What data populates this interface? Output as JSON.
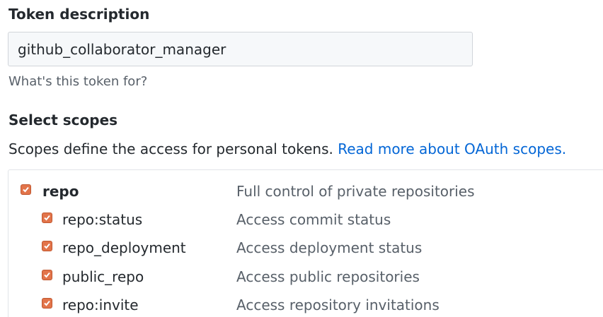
{
  "token": {
    "label": "Token description",
    "value": "github_collaborator_manager",
    "hint": "What's this token for?"
  },
  "scopes": {
    "heading": "Select scopes",
    "description": "Scopes define the access for personal tokens.",
    "link_text": "Read more about OAuth scopes.",
    "items": [
      {
        "name": "repo",
        "description": "Full control of private repositories",
        "checked": true
      },
      {
        "name": "repo:status",
        "description": "Access commit status",
        "checked": true
      },
      {
        "name": "repo_deployment",
        "description": "Access deployment status",
        "checked": true
      },
      {
        "name": "public_repo",
        "description": "Access public repositories",
        "checked": true
      },
      {
        "name": "repo:invite",
        "description": "Access repository invitations",
        "checked": true
      }
    ]
  },
  "colors": {
    "checkbox": "#e2744a",
    "link": "#0366d6",
    "muted": "#586069"
  }
}
